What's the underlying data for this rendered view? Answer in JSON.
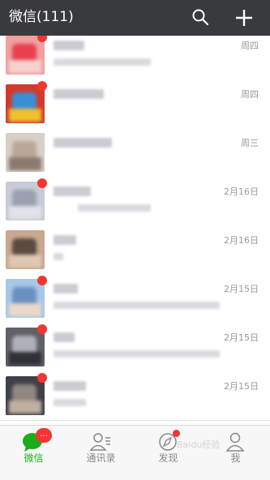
{
  "header": {
    "title": "微信(111)",
    "search_icon": "search-icon",
    "add_icon": "plus-icon",
    "background": "#393a3e"
  },
  "chats": [
    {
      "time": "周四",
      "unread": true,
      "avatar_colors": [
        "#f0a0a0",
        "#e84050",
        "#f7d0d0"
      ]
    },
    {
      "time": "周四",
      "unread": true,
      "avatar_colors": [
        "#d33a2c",
        "#3a8ed8",
        "#f0c030"
      ]
    },
    {
      "time": "周三",
      "unread": false,
      "avatar_colors": [
        "#d8cfc8",
        "#b8a898",
        "#8a7a70"
      ]
    },
    {
      "time": "2月16日",
      "unread": true,
      "avatar_colors": [
        "#c8ccd8",
        "#9aa0b0",
        "#e0e2ea"
      ]
    },
    {
      "time": "2月16日",
      "unread": false,
      "avatar_colors": [
        "#c8a890",
        "#5a4a40",
        "#e0c8b0"
      ]
    },
    {
      "time": "2月15日",
      "unread": true,
      "avatar_colors": [
        "#a8c8e8",
        "#6a90c0",
        "#e8d8c8"
      ]
    },
    {
      "time": "2月15日",
      "unread": true,
      "avatar_colors": [
        "#606068",
        "#b0b0b8",
        "#303038"
      ]
    },
    {
      "time": "2月15日",
      "unread": true,
      "avatar_colors": [
        "#404048",
        "#908880",
        "#c0b0a0"
      ]
    }
  ],
  "tabs": [
    {
      "label": "微信",
      "icon": "chat-bubble-icon",
      "active": true,
      "badge": "..."
    },
    {
      "label": "通讯录",
      "icon": "contacts-icon",
      "active": false
    },
    {
      "label": "发现",
      "icon": "compass-icon",
      "active": false,
      "dot": true
    },
    {
      "label": "我",
      "icon": "person-icon",
      "active": false
    }
  ],
  "watermark": "Baidu经验",
  "colors": {
    "accent": "#1aad19",
    "badge": "#f43530"
  }
}
